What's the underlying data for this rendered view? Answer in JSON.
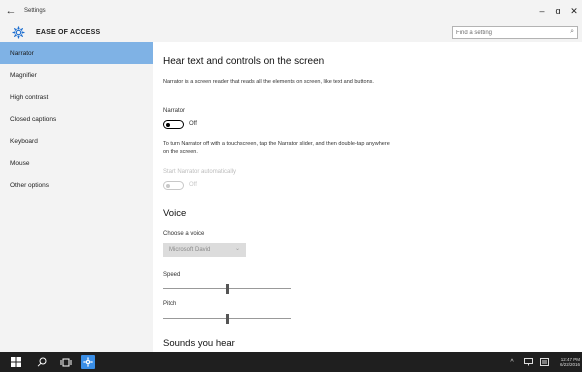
{
  "window": {
    "title": "Settings",
    "back_glyph": "←",
    "minimize_glyph": "–",
    "maximize_glyph": "ɑ",
    "close_glyph": "✕"
  },
  "header": {
    "app_title": "EASE OF ACCESS",
    "search_placeholder": "Find a setting"
  },
  "sidebar": {
    "items": [
      {
        "label": "Narrator",
        "active": true
      },
      {
        "label": "Magnifier"
      },
      {
        "label": "High contrast"
      },
      {
        "label": "Closed captions"
      },
      {
        "label": "Keyboard"
      },
      {
        "label": "Mouse"
      },
      {
        "label": "Other options"
      }
    ]
  },
  "main": {
    "heading": "Hear text and controls on the screen",
    "description": "Narrator is a screen reader that reads all the elements on screen, like text and buttons.",
    "narrator_label": "Narrator",
    "narrator_state": "Off",
    "instruction": "To turn Narrator off with a touchscreen, tap the Narrator slider, and then double-tap anywhere on the screen.",
    "auto_start_label": "Start Narrator automatically",
    "auto_start_state": "Off",
    "voice_heading": "Voice",
    "choose_voice_label": "Choose a voice",
    "voice_selected": "Microsoft David",
    "speed_label": "Speed",
    "speed_value": 0.5,
    "pitch_label": "Pitch",
    "pitch_value": 0.5,
    "sounds_heading": "Sounds you hear"
  },
  "taskbar": {
    "clock_time": "12:47 PM",
    "clock_date": "6/22/2016"
  },
  "colors": {
    "accent_selected": "#7fb2e5",
    "taskbar": "#1f1f1f",
    "settings_tile": "#3a8ee6"
  }
}
